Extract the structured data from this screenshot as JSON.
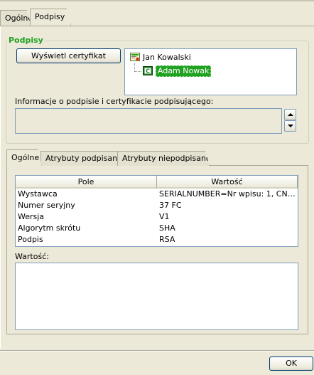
{
  "top_tabs": [
    {
      "label": "Ogólne",
      "active": false
    },
    {
      "label": "Podpisy",
      "active": true
    }
  ],
  "signatures": {
    "group_title": "Podpisy",
    "show_certificate_label": "Wyświetl certyfikat",
    "tree": {
      "root": "Jan Kowalski",
      "child": "Adam Nowak"
    },
    "info_label": "Informacje o podpisie i certyfikacie podpisującego:",
    "info_value": ""
  },
  "inner_tabs": [
    {
      "label": "Ogólne",
      "active": true
    },
    {
      "label": "Atrybuty podpisane",
      "active": false
    },
    {
      "label": "Atrybuty niepodpisane",
      "active": false
    }
  ],
  "grid": {
    "columns": [
      "Pole",
      "Wartość"
    ],
    "rows": [
      [
        "Wystawca",
        "SERIALNUMBER=Nr wpisu: 1, CN=CE..."
      ],
      [
        "Numer seryjny",
        "37 FC"
      ],
      [
        "Wersja",
        "V1"
      ],
      [
        "Algorytm skrótu",
        "SHA"
      ],
      [
        "Podpis",
        "RSA"
      ]
    ]
  },
  "value_label": "Wartość:",
  "value_text": "",
  "ok_label": "OK",
  "colors": {
    "accent_green": "#21a121",
    "window_bg": "#ece9d8",
    "field_border": "#7f9db9"
  }
}
